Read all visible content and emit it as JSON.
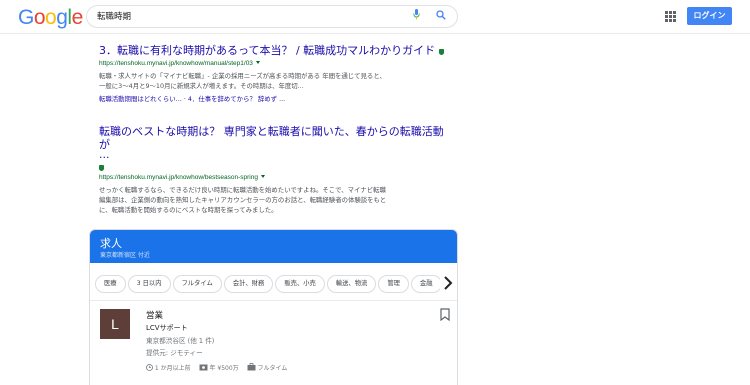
{
  "header": {
    "logo_letters": [
      "G",
      "o",
      "o",
      "g",
      "l",
      "e"
    ],
    "logo_colors": [
      "#4285f4",
      "#ea4335",
      "#fbbc05",
      "#4285f4",
      "#34a853",
      "#ea4335"
    ],
    "search_value": "転職時期",
    "login_label": "ログイン",
    "icons": [
      "mic-icon",
      "search-icon",
      "apps-icon"
    ]
  },
  "results": [
    {
      "title": "3．転職に有利な時期があるって本当？ / 転職成功マルわかりガイド",
      "url": "https://tenshoku.mynavi.jp/knowhow/manual/step1/03",
      "snippet": [
        "転職・求人サイトの「マイナビ転職」- 企業の採用ニーズが高まる時期がある 年間を通じて見ると、",
        "一般に3～4月と9～10月に新規求人が増えます。その時期は、年度切..."
      ],
      "sitelinks": "転職活動期間はどれくらい... · 4．仕事を辞めてから？ 辞めず ..."
    },
    {
      "title_line1": "転職のベストな時期は？ 専門家と転職者に聞いた、春からの転職活動が",
      "title_line2": "...",
      "url": "https://tenshoku.mynavi.jp/knowhow/bestseason-spring",
      "snippet": [
        "せっかく転職するなら、できるだけ良い時期に転職活動を始めたいですよね。そこで、マイナビ転職",
        "編集部は、企業側の動向を熟知したキャリアカウンセラーの方のお話と、転職経験者の体験談をもと",
        "に、転職活動を開始するのにベストな時期を探ってみました。"
      ]
    }
  ],
  "jobs": {
    "title": "求人",
    "subtitle": "東京都新宿区 付近",
    "header_color": "#1a73e8",
    "filters": [
      "医療",
      "3 日以内",
      "フルタイム",
      "会計、財務",
      "販売、小売",
      "輸送、物流",
      "管理",
      "金融"
    ],
    "listing": {
      "avatar_letter": "L",
      "avatar_color": "#5d3e38",
      "title": "営業",
      "company": "LCVサポート",
      "location": "東京都渋谷区 (他 1 件)",
      "source": "提供元: ジモティー",
      "posted": "1 か月以上前",
      "salary": "年 ¥500万",
      "type": "フルタイム"
    }
  }
}
